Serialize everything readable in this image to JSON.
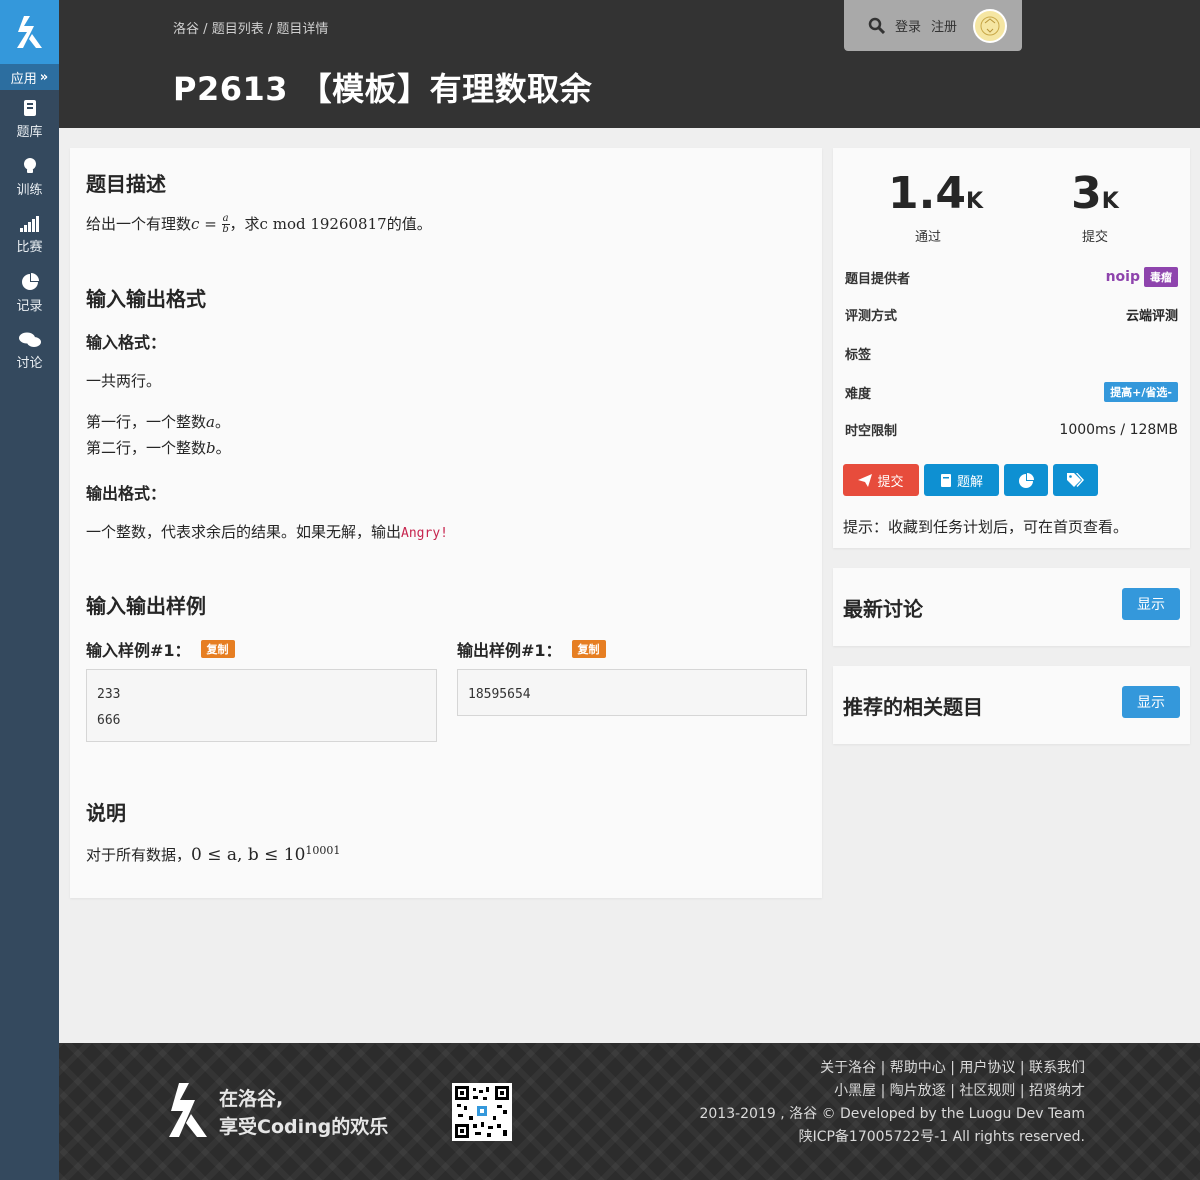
{
  "sidebar": {
    "app_label": "应用",
    "items": [
      {
        "label": "题库",
        "icon": "book-icon"
      },
      {
        "label": "训练",
        "icon": "lightbulb-icon"
      },
      {
        "label": "比赛",
        "icon": "signal-icon"
      },
      {
        "label": "记录",
        "icon": "pie-chart-icon"
      },
      {
        "label": "讨论",
        "icon": "comments-icon"
      }
    ]
  },
  "header": {
    "breadcrumb": [
      "洛谷",
      "题目列表",
      "题目详情"
    ],
    "breadcrumb_sep": "/",
    "title": "P2613 【模板】有理数取余",
    "login": "登录",
    "register": "注册"
  },
  "problem": {
    "description_title": "题目描述",
    "description_pre": "给出一个有理数",
    "description_c": "c",
    "description_eq": "=",
    "description_a": "a",
    "description_b": "b",
    "description_mid": "，求",
    "description_mod": "c  mod 19260817",
    "description_post": "的值。",
    "io_title": "输入输出格式",
    "input_format_title": "输入格式：",
    "input_line1": "一共两行。",
    "input_line2_pre": "第一行，一个整数",
    "input_line2_var": "a",
    "input_line2_post": "。",
    "input_line3_pre": "第二行，一个整数",
    "input_line3_var": "b",
    "input_line3_post": "。",
    "output_format_title": "输出格式：",
    "output_line_pre": "一个整数，代表求余后的结果。如果无解，输出",
    "output_code": "Angry!",
    "samples_title": "输入输出样例",
    "sample_input_label": "输入样例#1：",
    "sample_output_label": "输出样例#1：",
    "copy_label": "复制",
    "sample_input_lines": [
      "233",
      "666"
    ],
    "sample_output_lines": [
      "18595654"
    ],
    "note_title": "说明",
    "note_pre": "对于所有数据，",
    "note_math": "0 ≤ a, b ≤ 10",
    "note_exp": "10001"
  },
  "stats": {
    "accepted_value": "1.4",
    "accepted_unit": "K",
    "accepted_label": "通过",
    "submitted_value": "3",
    "submitted_unit": "K",
    "submitted_label": "提交"
  },
  "info": {
    "provider_key": "题目提供者",
    "provider_name": "noip",
    "provider_badge": "毒瘤",
    "judge_key": "评测方式",
    "judge_value": "云端评测",
    "tags_key": "标签",
    "difficulty_key": "难度",
    "difficulty_value": "提高+/省选-",
    "limit_key": "时空限制",
    "limit_value": "1000ms / 128MB"
  },
  "actions": {
    "submit_label": "提交",
    "solution_label": "题解",
    "hint": "提示：收藏到任务计划后，可在首页查看。"
  },
  "panels": {
    "discussion_title": "最新讨论",
    "related_title": "推荐的相关题目",
    "show_label": "显示"
  },
  "footer": {
    "slogan_line1": "在洛谷,",
    "slogan_line2": "享受Coding的欢乐",
    "links_line1": "关于洛谷 | 帮助中心 | 用户协议 | 联系我们",
    "links_line2": "小黑屋 | 陶片放逐 | 社区规则 | 招贤纳才",
    "copyright": "2013-2019 , 洛谷 © Developed by the Luogu Dev Team",
    "icp": "陕ICP备17005722号-1 All rights reserved."
  },
  "colors": {
    "brand_blue": "#3498db",
    "sidebar": "#34495e",
    "header": "#333333",
    "submit_red": "#e74c3c",
    "copy_orange": "#e67e22",
    "provider_purple": "#8e44ad",
    "difficulty_blue": "#3498db"
  }
}
